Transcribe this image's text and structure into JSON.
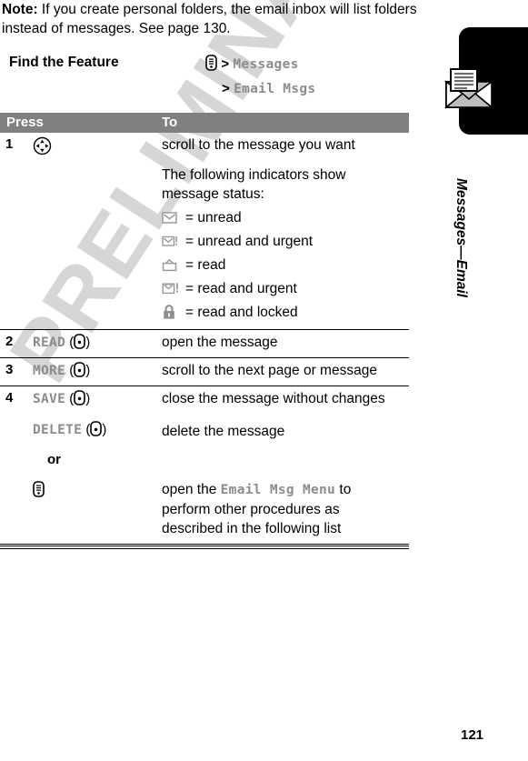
{
  "note": {
    "label": "Note:",
    "text": " If you create personal folders, the email inbox will list folders instead of messages. See page 130."
  },
  "find_the_feature": {
    "label": "Find the Feature",
    "lines": [
      {
        "icon": "menu-key-icon",
        "separator": ">",
        "value": "Messages"
      },
      {
        "icon": "",
        "separator": ">",
        "value": "Email Msgs"
      }
    ]
  },
  "table": {
    "headers": {
      "press": "Press",
      "to": "To"
    },
    "rows": [
      {
        "num": "1",
        "press_icon": "navigation-key-icon",
        "press_text": "",
        "to_lines": [
          "scroll to the message you want",
          "The following indicators show message status:"
        ],
        "indicators": [
          {
            "icon": "envelope-closed-icon",
            "text": "= unread"
          },
          {
            "icon": "envelope-closed-urgent-icon",
            "text": "= unread and urgent"
          },
          {
            "icon": "envelope-open-icon",
            "text": "= read"
          },
          {
            "icon": "envelope-open-urgent-icon",
            "text": "= read and urgent"
          },
          {
            "icon": "padlock-icon",
            "text": "= read and locked"
          }
        ]
      },
      {
        "num": "2",
        "press_text": "READ",
        "press_icon": "soft-key-icon",
        "to_lines": [
          "open the message"
        ]
      },
      {
        "num": "3",
        "press_text": "MORE",
        "press_icon": "soft-key-icon",
        "to_lines": [
          "scroll to the next page or message"
        ]
      },
      {
        "num": "4",
        "press_text": "SAVE",
        "press_icon": "soft-key-icon",
        "to_lines": [
          "close the message without changes"
        ]
      },
      {
        "num": "",
        "press_text": "DELETE",
        "press_icon": "soft-key-icon",
        "to_lines": [
          "delete the message"
        ]
      },
      {
        "num": "",
        "or_word": "or",
        "press_text": "",
        "press_icon": "",
        "to_lines": []
      },
      {
        "num": "",
        "press_text": "",
        "press_icon": "menu-key-icon",
        "to_prefix": "open the ",
        "to_mono": "Email Msg Menu",
        "to_suffix": " to perform other procedures as described in the following list"
      }
    ]
  },
  "sidebar": {
    "tab_icon": "email-envelope-document-icon",
    "title": "Messages—Email"
  },
  "page_number": "121",
  "watermark": "PRELIMINARY",
  "colors": {
    "header_bar": "#808080",
    "mono_text": "#8c8c8c",
    "watermark": "#d6d6d6",
    "tab": "#000000"
  }
}
